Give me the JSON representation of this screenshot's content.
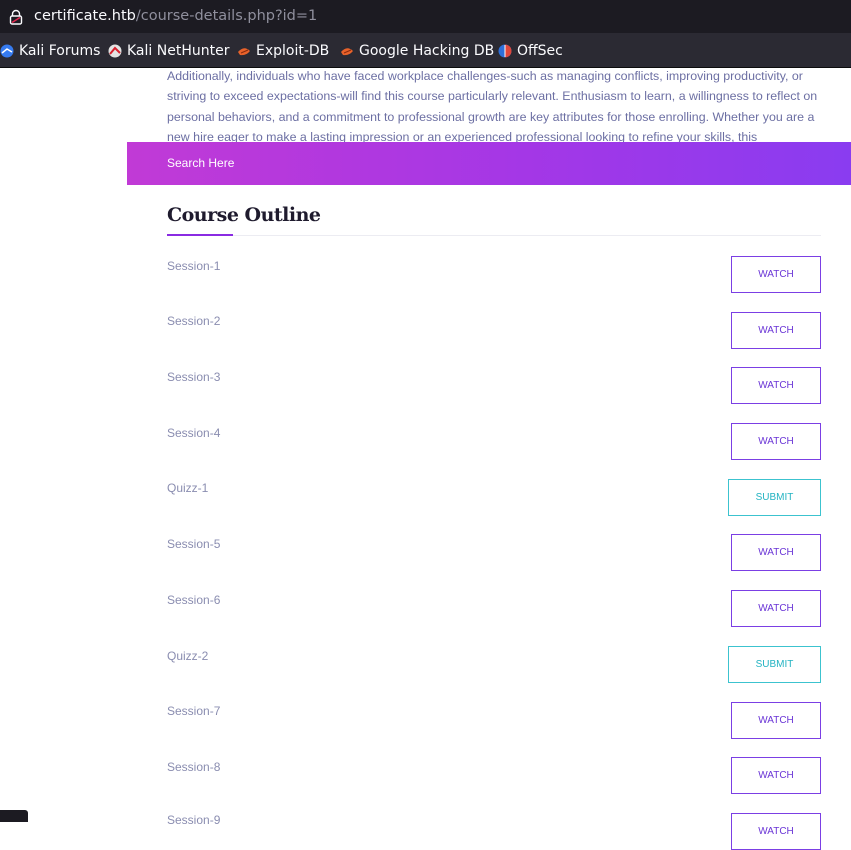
{
  "browser": {
    "url_host": "certificate.htb",
    "url_path": "/course-details.php?id=1",
    "bookmarks": [
      {
        "label": "Kali Forums",
        "icon": "kali-forums-icon"
      },
      {
        "label": "Kali NetHunter",
        "icon": "kali-nethunter-icon"
      },
      {
        "label": "Exploit-DB",
        "icon": "exploit-db-icon"
      },
      {
        "label": "Google Hacking DB",
        "icon": "google-hacking-db-icon"
      },
      {
        "label": "OffSec",
        "icon": "offsec-icon"
      }
    ]
  },
  "page": {
    "intro_text": "Additionally, individuals who have faced workplace challenges-such as managing conflicts, improving productivity, or striving to exceed expectations-will find this course particularly relevant. Enthusiasm to learn, a willingness to reflect on personal behaviors, and a commitment to professional growth are key attributes for those enrolling. Whether you are a new hire eager to make a lasting impression or an experienced professional looking to refine your skills, this",
    "search_placeholder": "Search Here",
    "outline_title": "Course Outline",
    "sessions": [
      {
        "label": "Session-1",
        "action": "WATCH"
      },
      {
        "label": "Session-2",
        "action": "WATCH"
      },
      {
        "label": "Session-3",
        "action": "WATCH"
      },
      {
        "label": "Session-4",
        "action": "WATCH"
      },
      {
        "label": "Quizz-1",
        "action": "SUBMIT"
      },
      {
        "label": "Session-5",
        "action": "WATCH"
      },
      {
        "label": "Session-6",
        "action": "WATCH"
      },
      {
        "label": "Quizz-2",
        "action": "SUBMIT"
      },
      {
        "label": "Session-7",
        "action": "WATCH"
      },
      {
        "label": "Session-8",
        "action": "WATCH"
      },
      {
        "label": "Session-9",
        "action": "WATCH"
      }
    ]
  },
  "colors": {
    "accent_purple": "#7b3fe4",
    "accent_cyan": "#3cc3cf",
    "search_gradient_start": "#c13ad6",
    "search_gradient_end": "#8a3cf0"
  }
}
